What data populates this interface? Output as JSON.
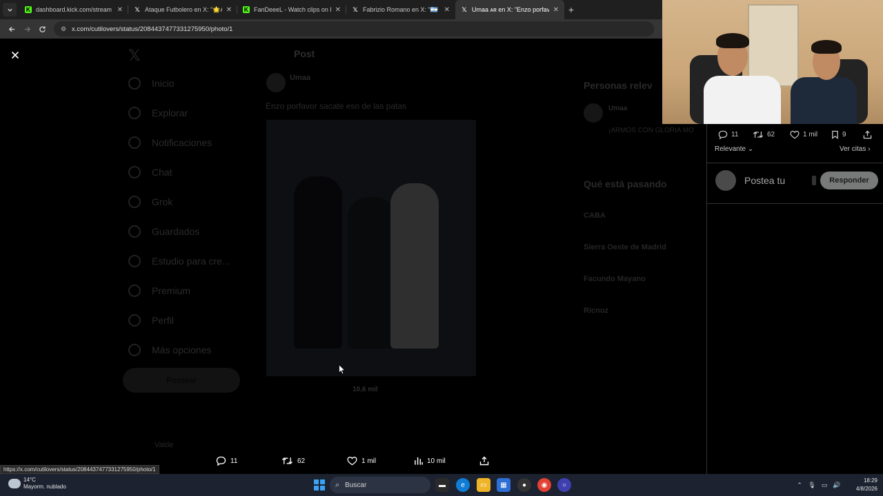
{
  "browser": {
    "tabs": [
      {
        "title": "dashboard.kick.com/stream",
        "favicon": "kick-icon",
        "favicon_color": "#53fc18",
        "active": false
      },
      {
        "title": "Ataque Futbolero en X: \"🌟ARG",
        "favicon": "x-icon",
        "favicon_color": "#ffffff",
        "active": false
      },
      {
        "title": "FanDeeeL - Watch clips on Kick",
        "favicon": "kick-icon",
        "favicon_color": "#53fc18",
        "active": false
      },
      {
        "title": "Fabrizio Romano en X: \"🇦🇷 🟣 I",
        "favicon": "x-icon",
        "favicon_color": "#ffffff",
        "active": false
      },
      {
        "title": "Umaa ᴀʀ en X: \"Enzo porfavor s",
        "favicon": "x-icon",
        "favicon_color": "#ffffff",
        "active": true
      }
    ],
    "new_tab": "+",
    "url": "x.com/cutilovers/status/2084437477331275950/photo/1",
    "status_url": "https://x.com/cutilovers/status/2084437477331275950/photo/1"
  },
  "x_sidebar": {
    "items": [
      "Inicio",
      "Explorar",
      "Notificaciones",
      "Chat",
      "Grok",
      "Guardados",
      "Estudio para cre...",
      "Premium",
      "Perfil",
      "Más opciones"
    ],
    "post_button": "Postear",
    "account_name": "Valde"
  },
  "post": {
    "header": "Post",
    "author": "Umaa",
    "text": "Enzo porfavor sacate eso de las patas",
    "views_inline": "10,6 mil"
  },
  "right_sidebar": {
    "relevant_people": "Personas relev",
    "relevant_user": "Umaa",
    "relevant_bio": "¡ARMOS CON GLORIA MO",
    "whats_happening": "Qué está pasando",
    "trends": [
      "CABA",
      "Sierra Oeste de Madrid",
      "Facundo Mayano",
      "Ricnoz"
    ]
  },
  "photo_actions": {
    "replies": "11",
    "reposts": "62",
    "likes": "1 mil",
    "views": "10 mil"
  },
  "reply_panel": {
    "replies": "11",
    "reposts": "62",
    "likes": "1 mil",
    "bookmarks": "9",
    "sort_label": "Relevante",
    "quotes_label": "Ver citas",
    "compose_placeholder": "Postea tu",
    "reply_button": "Responder"
  },
  "taskbar": {
    "weather_temp": "14°C",
    "weather_desc": "Mayorm. nublado",
    "search_label": "Buscar",
    "time": "18:29",
    "date": "4/8/2026"
  },
  "colors": {
    "accent_kick": "#53fc18",
    "windows_blue": "#3ba3f5",
    "reply_button_bg": "#787a7a"
  }
}
